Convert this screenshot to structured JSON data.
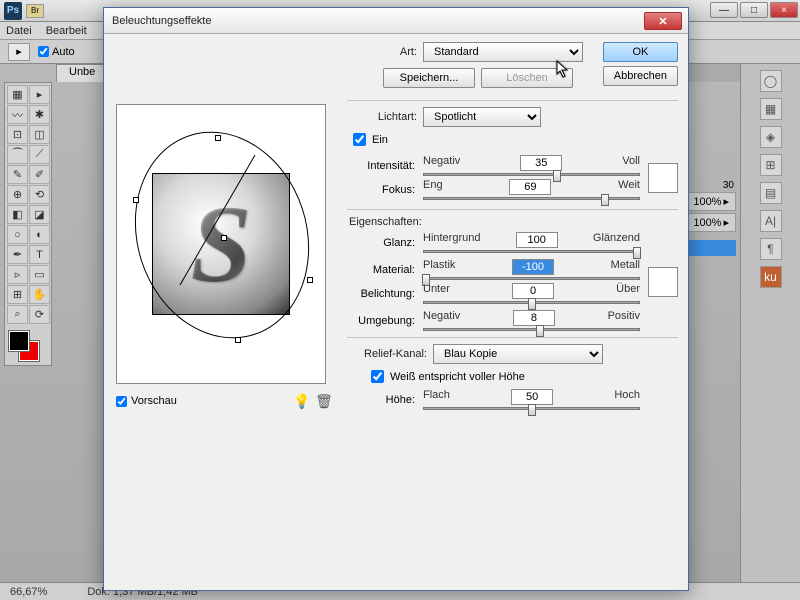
{
  "app": {
    "ps": "Ps",
    "br": "Br"
  },
  "menu": {
    "datei": "Datei",
    "bearbeiten": "Bearbeit"
  },
  "optbar": {
    "auto": "Auto"
  },
  "tabs": {
    "doc": "Unbe"
  },
  "winbtns": {
    "min": "—",
    "max": "□",
    "close": "×"
  },
  "ruler": {
    "tick": "30"
  },
  "right": {
    "p1": "100%",
    "p2": "100%",
    "al": "A|",
    "ku": "ku"
  },
  "dialog": {
    "title": "Beleuchtungseffekte",
    "ok": "OK",
    "cancel": "Abbrechen",
    "art": "Art:",
    "art_val": "Standard",
    "save": "Speichern...",
    "delete": "Löschen",
    "lichtart": "Lichtart:",
    "lichtart_val": "Spotlicht",
    "ein": "Ein",
    "intensitaet": "Intensität:",
    "negativ": "Negativ",
    "voll": "Voll",
    "intens_val": "35",
    "fokus": "Fokus:",
    "eng": "Eng",
    "weit": "Weit",
    "fokus_val": "69",
    "eigenschaften": "Eigenschaften:",
    "glanz": "Glanz:",
    "hintergrund": "Hintergrund",
    "glaenzend": "Glänzend",
    "glanz_val": "100",
    "material": "Material:",
    "plastik": "Plastik",
    "metall": "Metall",
    "material_val": "-100",
    "belichtung": "Belichtung:",
    "unter": "Unter",
    "ueber": "Über",
    "belicht_val": "0",
    "umgebung": "Umgebung:",
    "positiv": "Positiv",
    "umgeb_val": "8",
    "relief": "Relief-Kanal:",
    "relief_val": "Blau Kopie",
    "weiss": "Weiß entspricht voller Höhe",
    "hoehe": "Höhe:",
    "flach": "Flach",
    "hoch": "Hoch",
    "hoehe_val": "50",
    "vorschau": "Vorschau"
  },
  "status": {
    "zoom": "66,67%",
    "dok": "Dok: 1,37 MB/1,42 MB"
  }
}
